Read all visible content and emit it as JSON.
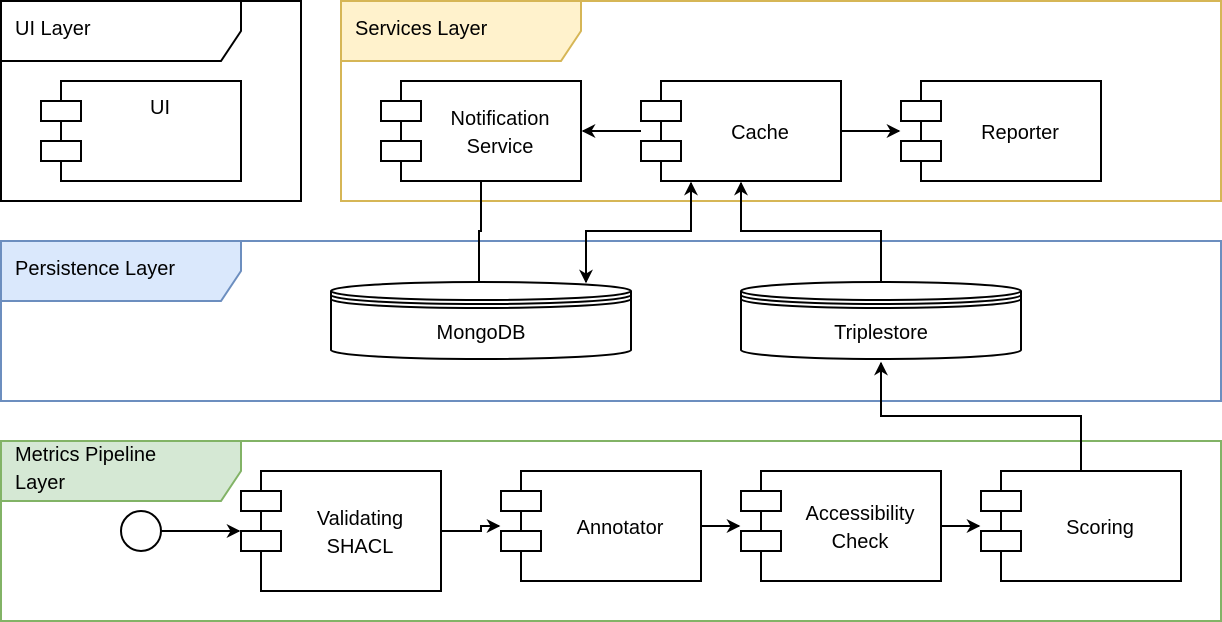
{
  "colors": {
    "services_fill": "#fff2cc",
    "services_stroke": "#d6b656",
    "persistence_fill": "#dae8fc",
    "persistence_stroke": "#6c8ebf",
    "metrics_fill": "#d5e8d4",
    "metrics_stroke": "#82b366"
  },
  "layers": {
    "ui": {
      "title": "UI Layer"
    },
    "services": {
      "title": "Services Layer"
    },
    "persistence": {
      "title": "Persistence Layer"
    },
    "metrics": {
      "title_line1": "Metrics Pipeline",
      "title_line2": "Layer"
    }
  },
  "components": {
    "ui": "UI",
    "notification": {
      "line1": "Notification",
      "line2": "Service"
    },
    "cache": "Cache",
    "reporter": "Reporter",
    "validating": {
      "line1": "Validating",
      "line2": "SHACL"
    },
    "annotator": "Annotator",
    "accessibility": {
      "line1": "Accessibility",
      "line2": "Check"
    },
    "scoring": "Scoring"
  },
  "databases": {
    "mongodb": "MongoDB",
    "triplestore": "Triplestore"
  }
}
